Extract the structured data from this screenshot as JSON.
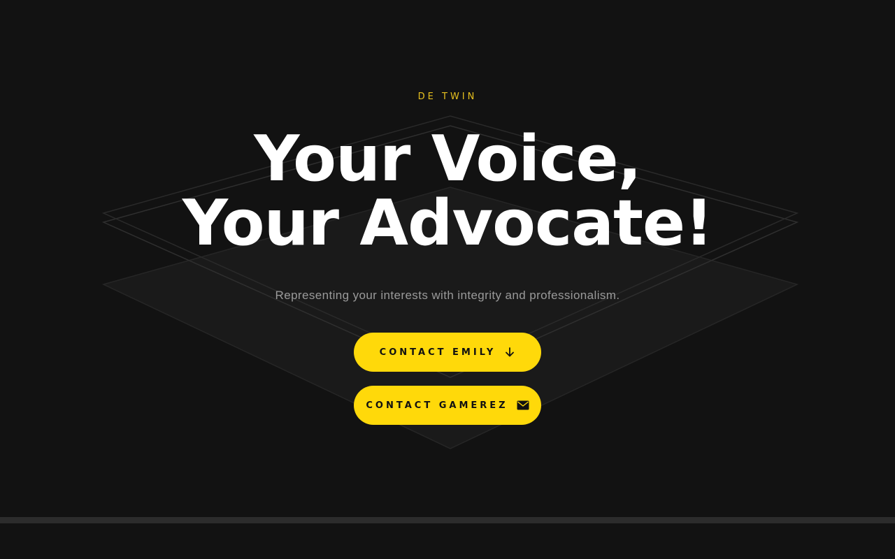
{
  "hero": {
    "eyebrow": "DE TWIN",
    "headline_line1": "Your Voice,",
    "headline_line2": "Your Advocate!",
    "subtitle": "Representing your interests with integrity and professionalism."
  },
  "buttons": {
    "contact_emily": "CONTACT EMILY",
    "contact_gamerez": "CONTACT GAMEREZ"
  },
  "icons": {
    "emily_icon": "arrow-down-icon",
    "gamerez_icon": "envelope-icon"
  },
  "colors": {
    "background": "#121212",
    "accent": "#ffd90a",
    "eyebrow": "#e6c01f",
    "text": "#ffffff",
    "muted": "#9a9a9a"
  }
}
